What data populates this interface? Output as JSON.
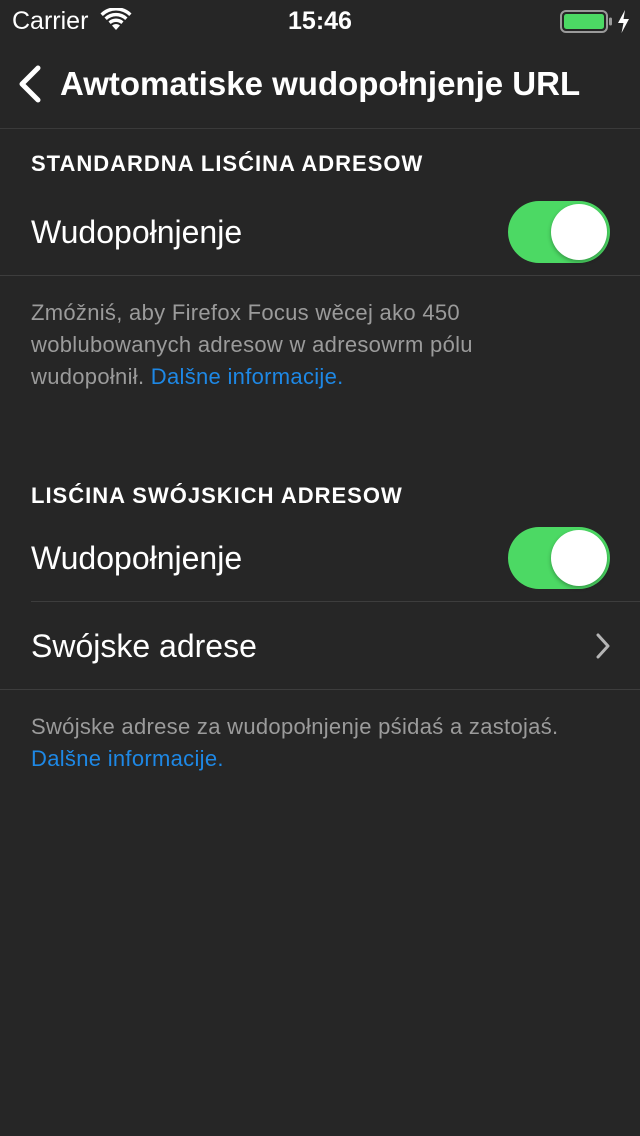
{
  "status_bar": {
    "carrier": "Carrier",
    "time": "15:46",
    "battery_level": 1.0,
    "battery_color": "#4cd964",
    "charging": true,
    "icons": [
      "wifi-icon",
      "battery-icon",
      "charging-bolt-icon"
    ]
  },
  "nav": {
    "back_icon": "chevron-left-icon",
    "title": "Awtomatiske wudopołnjenje URL"
  },
  "sections": [
    {
      "header": "STANDARDNA LISĆINA ADRESOW",
      "rows": [
        {
          "label": "Wudopołnjenje",
          "type": "toggle",
          "on": true
        }
      ],
      "footer_text": "Zmóžniś, aby Firefox Focus wěcej ako 450 woblubowanych adresow w adresowrm pólu wudopołnił. ",
      "footer_link": "Dalšne informacije."
    },
    {
      "header": "LISĆINA SWÓJSKICH ADRESOW",
      "rows": [
        {
          "label": "Wudopołnjenje",
          "type": "toggle",
          "on": true
        },
        {
          "label": "Swójske adrese",
          "type": "disclosure",
          "icon": "chevron-right-icon"
        }
      ],
      "footer_text": "Swójske adrese za wudopołnjenje pśidaś a zastojaś. ",
      "footer_link": "Dalšne informacije."
    }
  ],
  "colors": {
    "background": "#262626",
    "toggle_on": "#4cd964",
    "link": "#1e88e5",
    "footer_text": "#9b9b9b"
  }
}
